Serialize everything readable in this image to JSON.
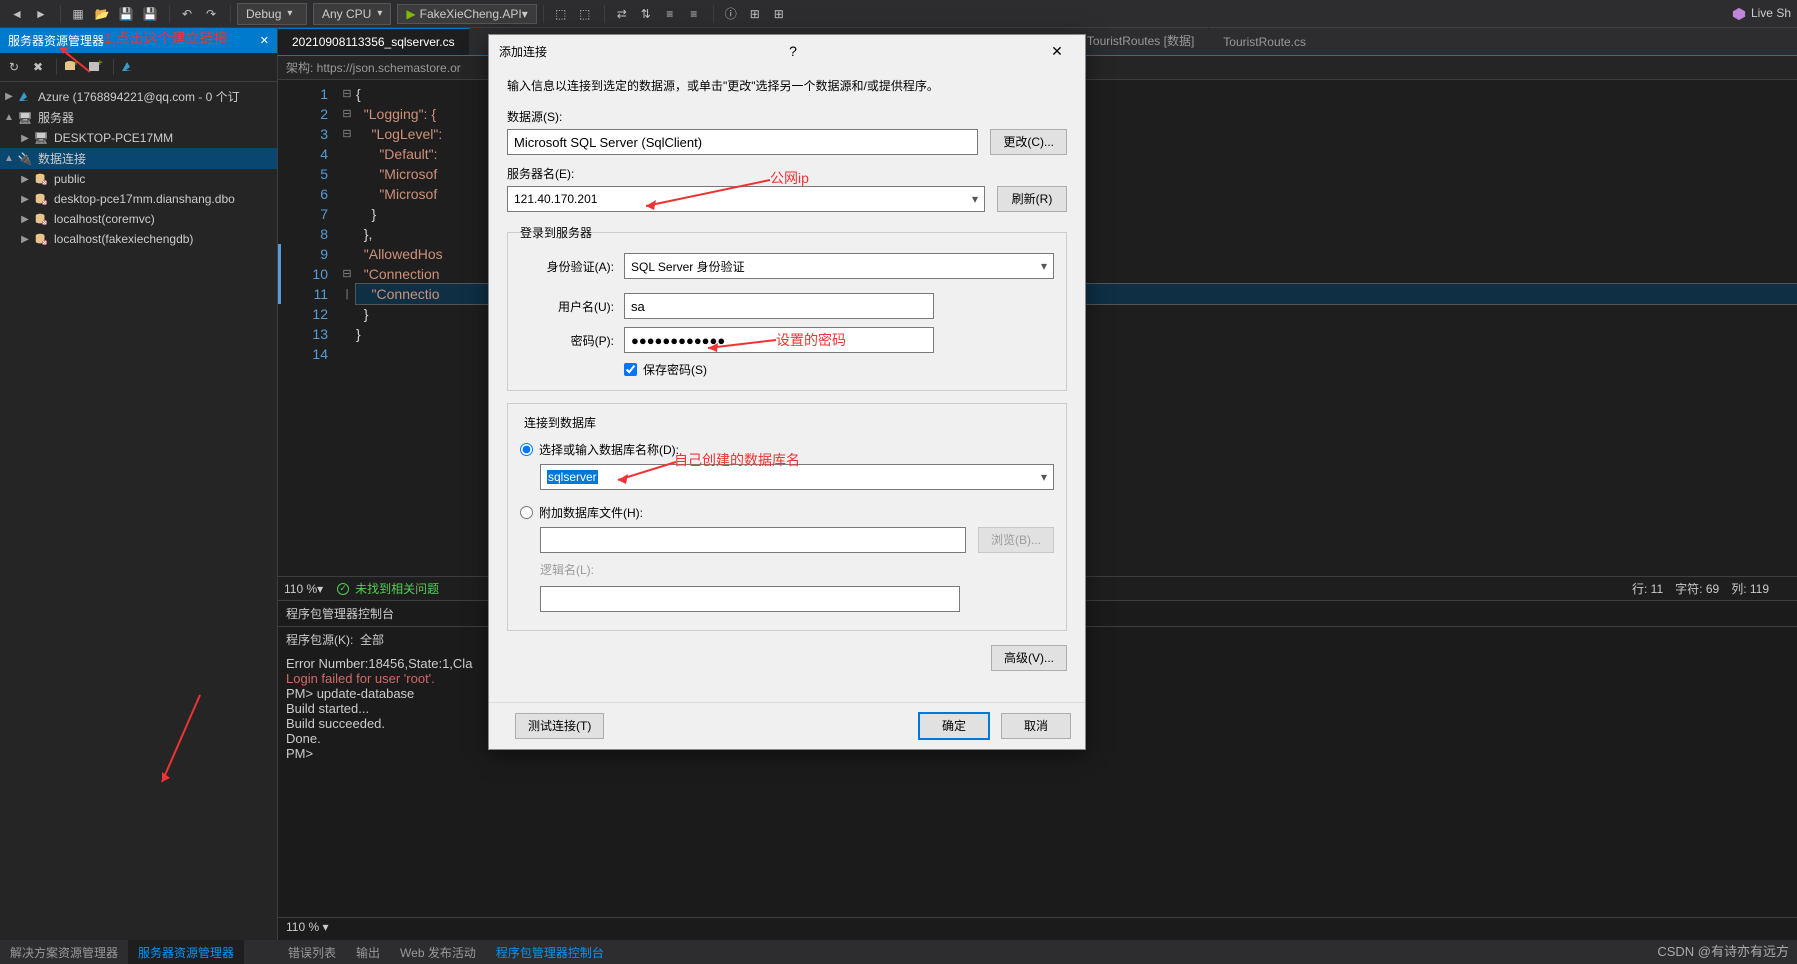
{
  "toolbar": {
    "config": "Debug",
    "platform": "Any CPU",
    "run_target": "FakeXieCheng.API",
    "live_share": "Live Sh"
  },
  "left": {
    "title": "服务器资源管理器",
    "azure": "Azure (1768894221@qq.com - 0 个订",
    "servers": "服务器",
    "desktop": "DESKTOP-PCE17MM",
    "data_conn": "数据连接",
    "items": [
      "public",
      "desktop-pce17mm.dianshang.dbo",
      "localhost(coremvc)",
      "localhost(fakexiechengdb)"
    ]
  },
  "tabs": {
    "t0": "20210908113356_sqlserver.cs",
    "t1": ".TouristRoutes [数据]",
    "t2": "TouristRoute.cs"
  },
  "schema_bar": "架构:  https://json.schemastore.or",
  "code": {
    "l1": "{",
    "l2": "  \"Logging\": {",
    "l3": "    \"LogLevel\":",
    "l4": "      \"Default\":",
    "l5": "      \"Microsof",
    "l6": "      \"Microsof",
    "l7": "    }",
    "l8": "  },",
    "l9": "  \"AllowedHos",
    "l10": "  \"Connection",
    "l11": "    \"Connectio",
    "l12": "  }",
    "l13": "}",
    "l14": ""
  },
  "editor_status": {
    "zoom": "110 %",
    "issues": "未找到相关问题",
    "line": "行: 11",
    "char": "字符: 69",
    "col": "列: 119"
  },
  "pm": {
    "title": "程序包管理器控制台",
    "src_label": "程序包源(K):",
    "src_value": "全部",
    "zoom": "110 %",
    "out": [
      "Error Number:18456,State:1,Cla",
      "Login failed for user 'root'.",
      "PM> update-database",
      "Build started...",
      "Build succeeded.",
      "Done.",
      "PM>"
    ]
  },
  "bottom_left": {
    "t0": "解决方案资源管理器",
    "t1": "服务器资源管理器"
  },
  "bottom_right": {
    "t0": "错误列表",
    "t1": "输出",
    "t2": "Web 发布活动",
    "t3": "程序包管理器控制台"
  },
  "dialog": {
    "title": "添加连接",
    "instr": "输入信息以连接到选定的数据源，或单击\"更改\"选择另一个数据源和/或提供程序。",
    "ds_label": "数据源(S):",
    "ds_value": "Microsoft SQL Server (SqlClient)",
    "change": "更改(C)...",
    "server_label": "服务器名(E):",
    "server_value": "121.40.170.201",
    "refresh": "刷新(R)",
    "login_legend": "登录到服务器",
    "auth_label": "身份验证(A):",
    "auth_value": "SQL Server 身份验证",
    "user_label": "用户名(U):",
    "user_value": "sa",
    "pw_label": "密码(P):",
    "pw_value": "●●●●●●●●●●●●",
    "save_pw": "保存密码(S)",
    "db_legend": "连接到数据库",
    "db_select_radio": "选择或输入数据库名称(D):",
    "db_name": "sqlserver",
    "db_attach_radio": "附加数据库文件(H):",
    "browse": "浏览(B)...",
    "logical_label": "逻辑名(L):",
    "advanced": "高级(V)...",
    "test": "测试连接(T)",
    "ok": "确定",
    "cancel": "取消"
  },
  "anno": {
    "a1": "1.点击这个建立链接",
    "a2": "公网ip",
    "a3": "设置的密码",
    "a4": "自己创建的数据库名"
  },
  "watermark": "CSDN @有诗亦有远方"
}
